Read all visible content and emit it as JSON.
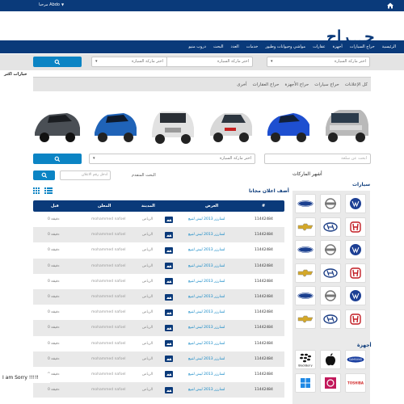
{
  "topbar": {
    "welcome": "مرحبا Abdo"
  },
  "brand": {
    "logo": "حـــراج"
  },
  "nav": {
    "items": [
      "الرئيسية",
      "حراج السيارات",
      "أجهزة",
      "عقارات",
      "مواشي وحيوانات وطيور",
      "خدمات",
      "العدد",
      "البحث",
      "دروب منيو"
    ]
  },
  "filters": {
    "make_placeholder": "اختر ماركة السيارة",
    "model_placeholder": "اختر ماركة السيارة",
    "year_placeholder": "اختر ماركة السيارة"
  },
  "more_label": "خيارات اكثر",
  "tabs": [
    "كل الإعلانات",
    "حراج سيارات",
    "حراج الأجهزة",
    "حراج العقارات",
    "أخرى"
  ],
  "filter2": {
    "search_placeholder": "ابحث عن سلعة",
    "make_placeholder": "اختر ماركة السيارة"
  },
  "adv_search": "البحث المتقدم",
  "ad_number_placeholder": "ادخل رقم الاعلان",
  "popular_makes": "أشهر الماركات",
  "cars_heading": "سيارات",
  "devices_heading": "أجهزة",
  "latest_title": "أضف اعلان مجانا",
  "table": {
    "headers": {
      "id": "#",
      "title": "العرض",
      "city": "المدينة",
      "user": "المعلن",
      "time": "قبل"
    },
    "rows": [
      {
        "id": "11442484",
        "title": "لشارزر 2013 ليش لتبيع",
        "city": "الرياض",
        "user": "mohammed nafoel",
        "time": "0 دقيقه"
      },
      {
        "id": "11442484",
        "title": "لشارزر 2013 ليش لتبيع",
        "city": "الرياض",
        "user": "mohammed nafoel",
        "time": "0 دقيقه"
      },
      {
        "id": "11442484",
        "title": "لشارزر 2013 ليش لتبيع",
        "city": "الرياض",
        "user": "mohammed nafoel",
        "time": "0 دقيقه"
      },
      {
        "id": "11442484",
        "title": "لشارزر 2013 ليش لتبيع",
        "city": "الرياض",
        "user": "mohammed nafoel",
        "time": "0 دقيقه"
      },
      {
        "id": "11442484",
        "title": "لشارزر 2013 ليش لتبيع",
        "city": "الرياض",
        "user": "mohammed nafoel",
        "time": "0 دقيقه"
      },
      {
        "id": "11442484",
        "title": "لشارزر 2013 ليش لتبيع",
        "city": "الرياض",
        "user": "mohammed nafoel",
        "time": "0 دقيقه"
      },
      {
        "id": "11442484",
        "title": "لشارزر 2013 ليش لتبيع",
        "city": "الرياض",
        "user": "mohammed nafoel",
        "time": "0 دقيقه"
      },
      {
        "id": "11442484",
        "title": "لشارزر 2013 ليش لتبيع",
        "city": "الرياض",
        "user": "mohammed nafoel",
        "time": "0 دقيقه"
      },
      {
        "id": "11442484",
        "title": "لشارزر 2013 ليش لتبيع",
        "city": "الرياض",
        "user": "mohammed nafoel",
        "time": "0 دقيقه"
      },
      {
        "id": "11442484",
        "title": "لشارزر 2013 ليش لتبيع",
        "city": "الرياض",
        "user": "mohammed nafoel",
        "time": "0 دقيقه"
      },
      {
        "id": "11442484",
        "title": "لشارزر 2013 ليش لتبيع",
        "city": "الرياض",
        "user": "mohammed nafoel",
        "time": "0 دقيقه"
      },
      {
        "id": "11442484",
        "title": "لشارزر 2013 ليش لتبيع",
        "city": "الرياض",
        "user": "mohammed nafoel",
        "time": "0 دقيقه"
      }
    ]
  },
  "device_brands": {
    "blackberry": "BlackBerry",
    "samsung": "SAMSUNG",
    "toshiba": "TOSHIBA"
  },
  "overlay": {
    "sorry": "I am Sorry !!!!!"
  },
  "colors": {
    "primary": "#0a3a7a",
    "accent": "#0b84c4"
  }
}
